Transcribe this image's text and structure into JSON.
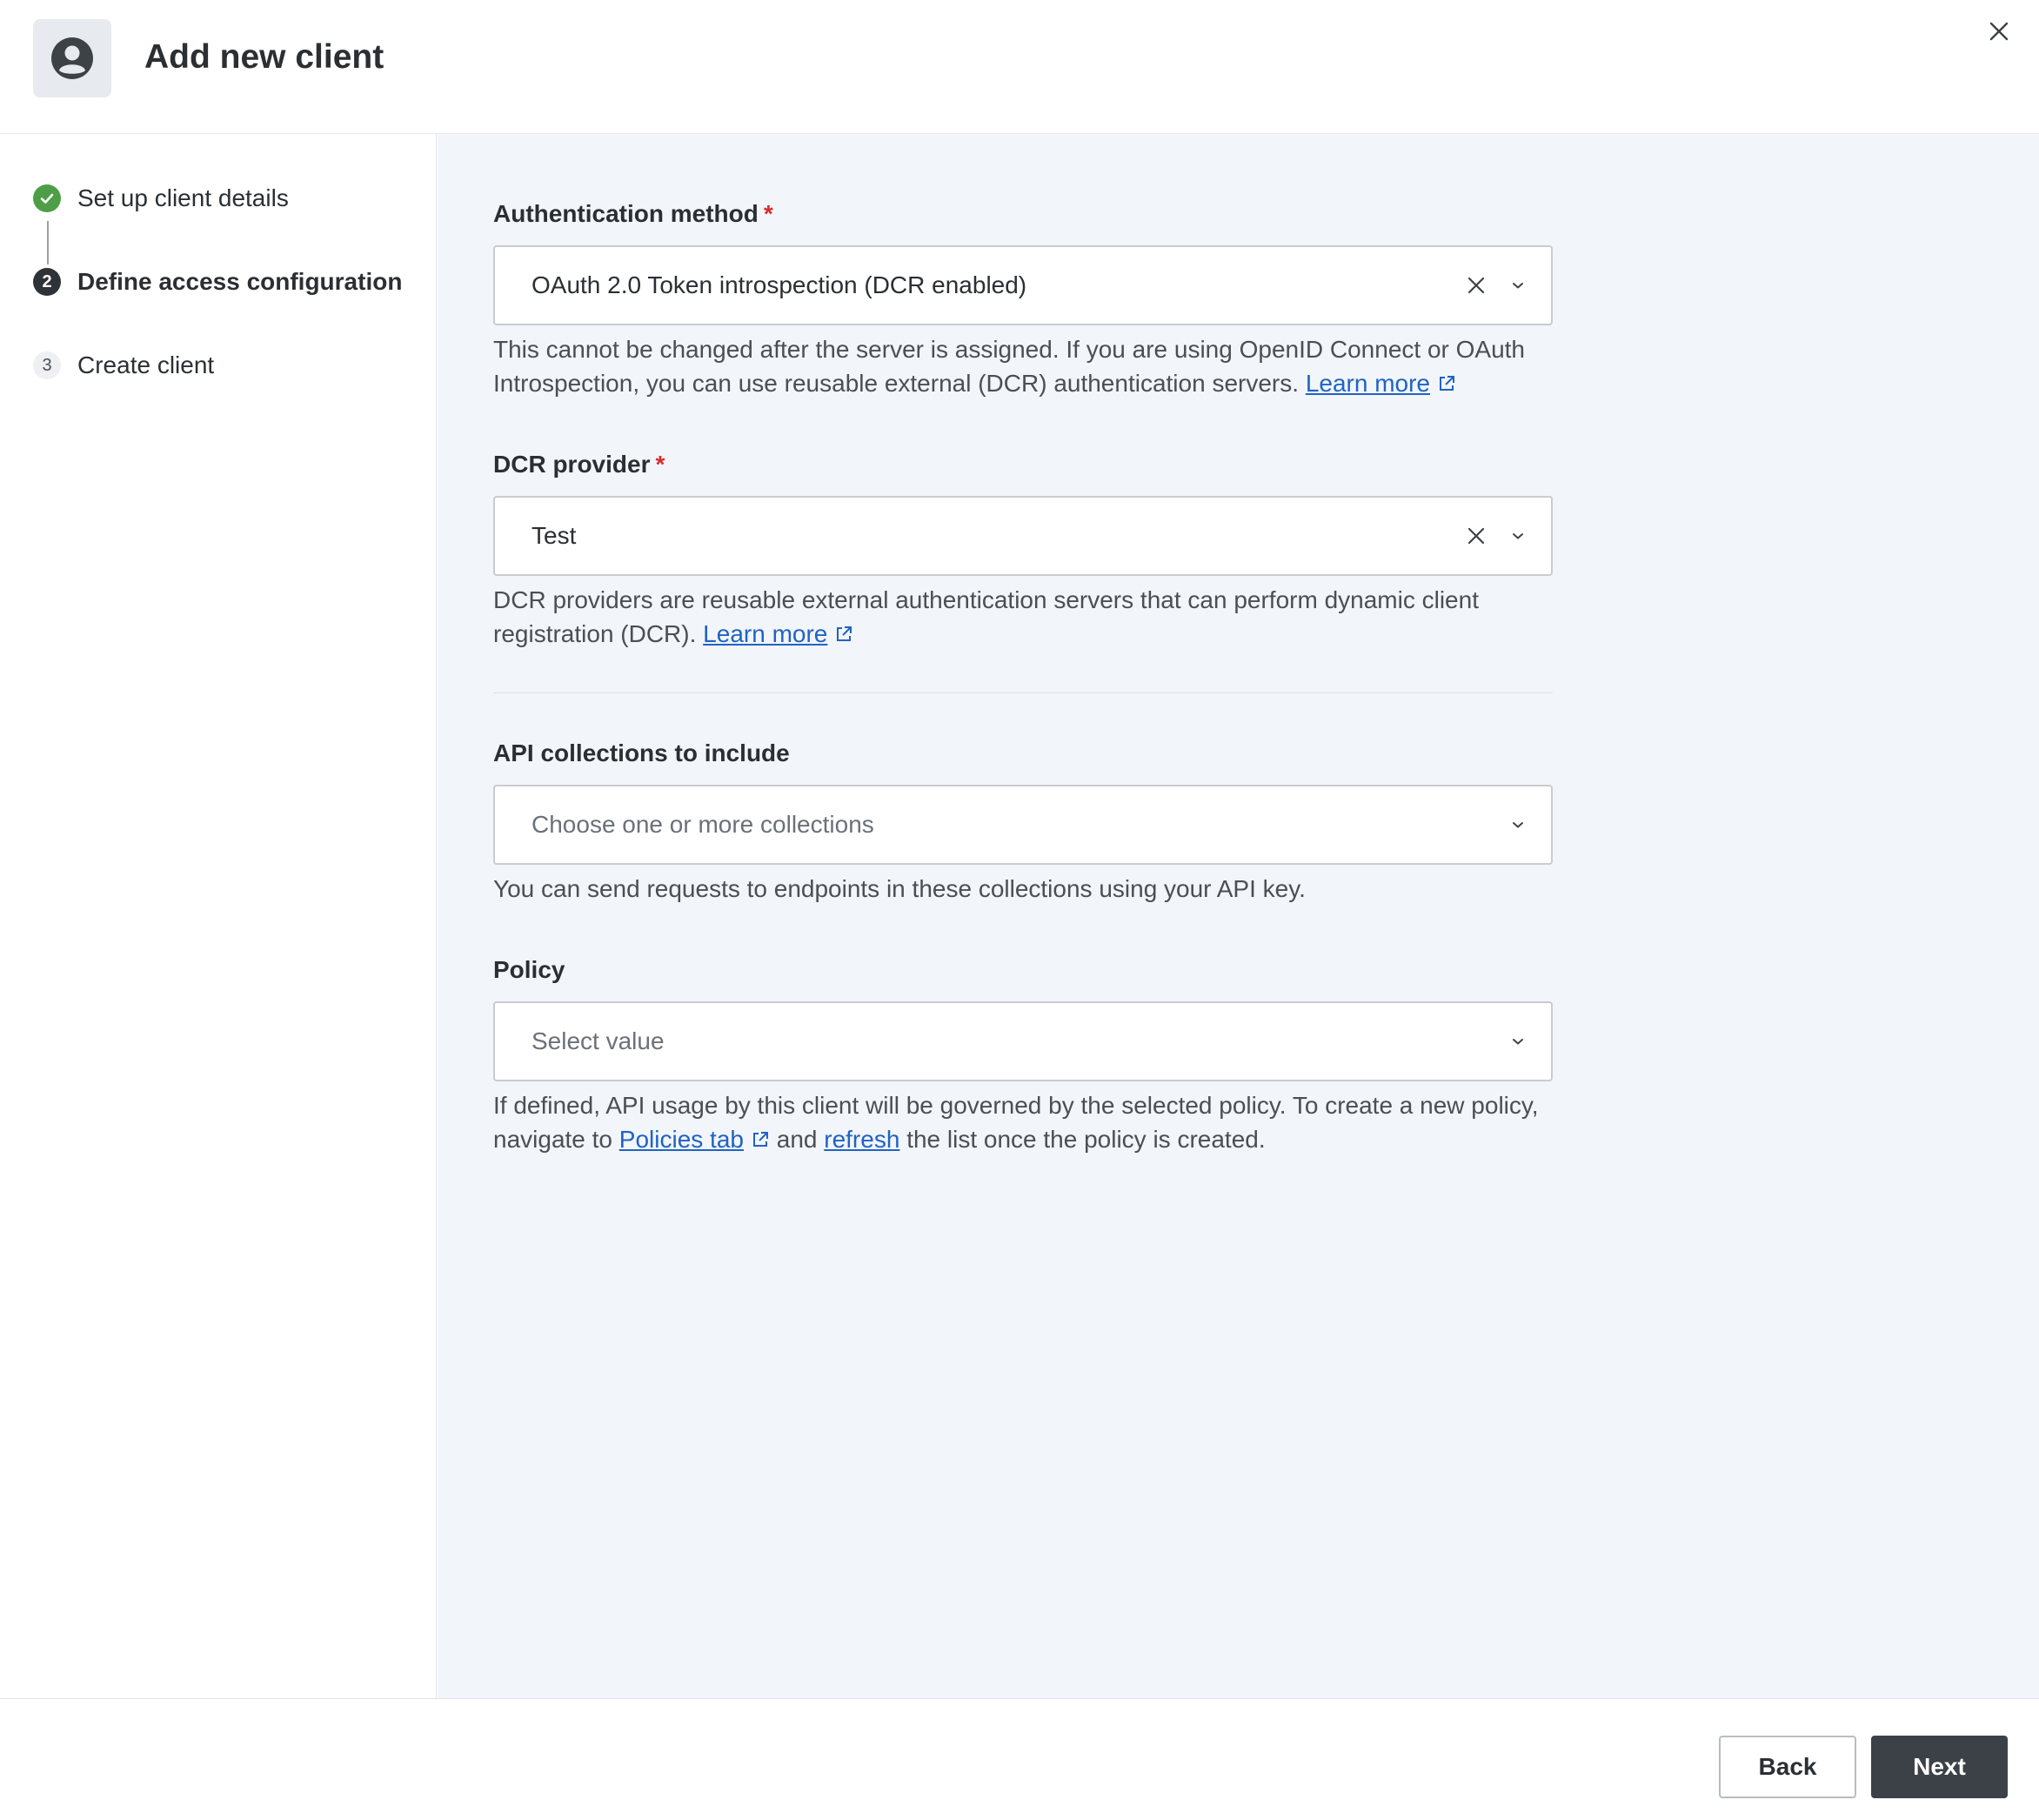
{
  "header": {
    "title": "Add new client",
    "icon": "user-avatar-icon"
  },
  "steps": [
    {
      "number": "1",
      "label": "Set up client details",
      "state": "completed"
    },
    {
      "number": "2",
      "label": "Define access configuration",
      "state": "active"
    },
    {
      "number": "3",
      "label": "Create client",
      "state": "pending"
    }
  ],
  "form": {
    "auth_method": {
      "label": "Authentication method",
      "required_mark": "*",
      "value": "OAuth 2.0 Token introspection (DCR enabled)",
      "help_text": "This cannot be changed after the server is assigned. If you are using OpenID Connect or OAuth Introspection, you can use reusable external (DCR) authentication servers.",
      "link_text": "Learn more"
    },
    "dcr_provider": {
      "label": "DCR provider",
      "required_mark": "*",
      "value": "Test",
      "help_text": "DCR providers are reusable external authentication servers that can perform dynamic client registration (DCR).",
      "link_text": "Learn more"
    },
    "api_collections": {
      "label": "API collections to include",
      "placeholder": "Choose one or more collections",
      "help_text": "You can send requests to endpoints in these collections using your API key."
    },
    "policy": {
      "label": "Policy",
      "placeholder": "Select value",
      "help_text_before": "If defined, API usage by this client will be governed by the selected policy. To create a new policy, navigate to",
      "policies_link": "Policies tab",
      "help_text_middle": "and",
      "refresh_link": "refresh",
      "help_text_after": "the list once the policy is created."
    }
  },
  "footer": {
    "back_label": "Back",
    "next_label": "Next"
  },
  "colors": {
    "accent_dark": "#3b4147",
    "success": "#4e9e47",
    "link": "#1f63c4",
    "required": "#d92c2c",
    "panel_bg": "#f2f5f9"
  }
}
